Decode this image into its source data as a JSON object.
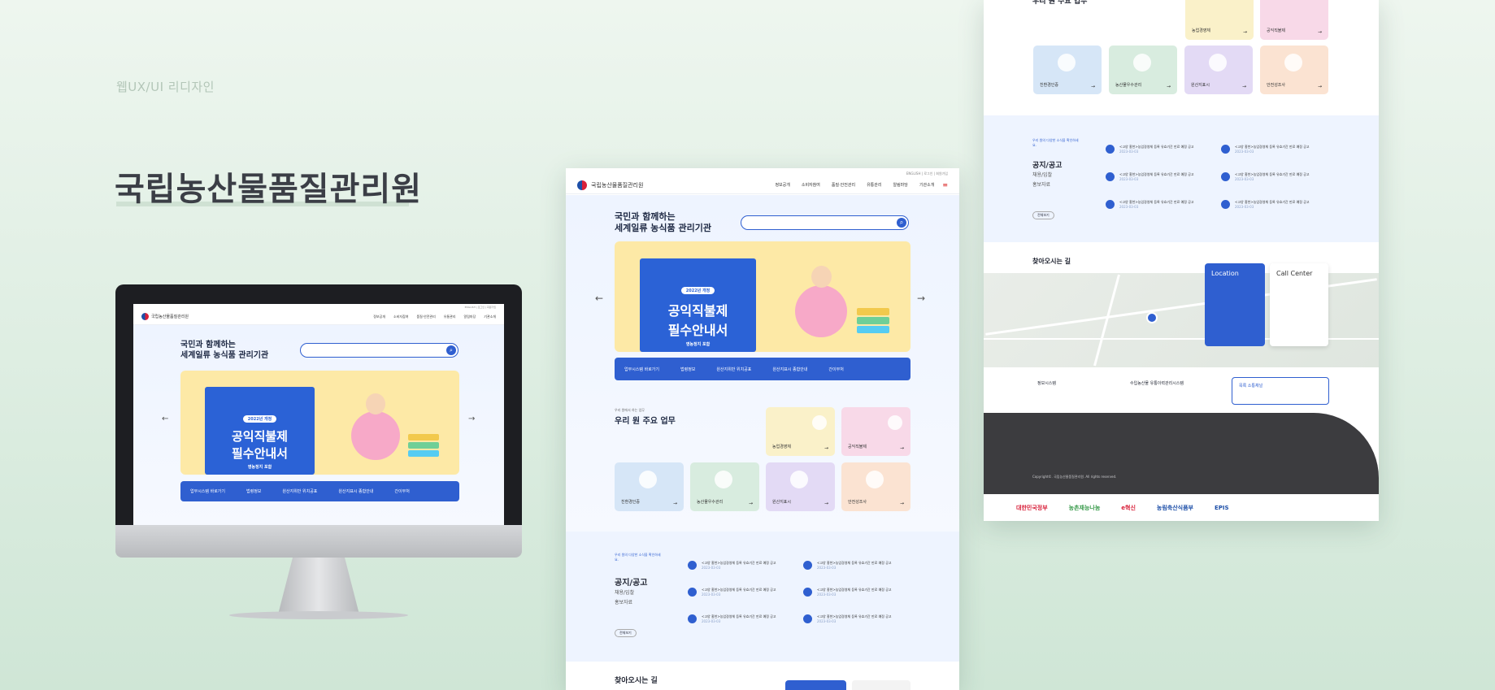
{
  "hero": {
    "tag": "웹UX/UI 리디자인",
    "title": "국립농산물품질관리원"
  },
  "site": {
    "logo_text": "국립농산물품질관리원",
    "nav": [
      "정보공개",
      "소비자참여",
      "품질·안전관리",
      "유통관리",
      "알림마당",
      "기관소개"
    ],
    "util": "ENGLISH | 로그인 | 회원가입",
    "hero_line1": "국민과 함께하는",
    "hero_line2": "세계일류 농식품 관리기관",
    "search_placeholder": "",
    "banner_pill": "2022년 개정",
    "banner_title1": "공익직불제",
    "banner_title2": "필수안내서",
    "banner_sub": "영농정지 포함",
    "quicklinks": [
      "업무시스템 바로가기",
      "법령정보",
      "원산지위반 위치공표",
      "원산지표시 종합안내",
      "간이부처"
    ],
    "tasks_small": "우리 원에서 하는 업무",
    "tasks_title": "우리 원 주요 업무",
    "tiles": [
      "농업경영체",
      "공익직불제",
      "친환경인증",
      "농산물우수관리",
      "원산지표시",
      "안전성조사"
    ],
    "notice_small": "우리 원의 다양한 소식을 확인하세요.",
    "notice_title": "공지/공고",
    "notice_sub1": "채용/입찰",
    "notice_sub2": "홍보자료",
    "notice_more": "전체보기",
    "notice_text": "<고양 홍천>농업경영체 등록 유효기간 만료 예정 공고",
    "notice_date": "2023-03-03",
    "map_title": "찾아오시는 길",
    "location_title": "Location",
    "call_title": "Call Center",
    "footer_links": [
      "정보시스템",
      "수입농산물 유통이력관리시스템",
      "목록 소통채널"
    ],
    "copyright": "Copyright©. 국립농산물품질관리원. All rights reserved.",
    "partners": [
      "대한민국정부",
      "농촌재능나눔",
      "e혁신",
      "농림축산식품부",
      "EPIS"
    ]
  }
}
